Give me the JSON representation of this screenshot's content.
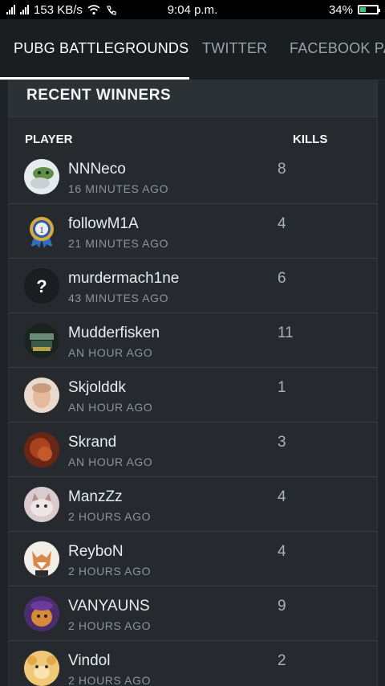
{
  "status_bar": {
    "network_speed": "153 KB/s",
    "time": "9:04 p.m.",
    "battery": "34%",
    "battery_level": 0.34
  },
  "tabs": [
    {
      "label": "PUBG BATTLEGROUNDS",
      "active": true
    },
    {
      "label": "TWITTER",
      "active": false
    },
    {
      "label": "FACEBOOK PA",
      "active": false
    }
  ],
  "card": {
    "title": "RECENT WINNERS",
    "col_player": "PLAYER",
    "col_kills": "KILLS"
  },
  "rows": [
    {
      "name": "NNNeco",
      "time": "16 MINUTES AGO",
      "kills": "8",
      "avatar": "frog-avatar"
    },
    {
      "name": "followM1A",
      "time": "21 MINUTES AGO",
      "kills": "4",
      "avatar": "medal-avatar"
    },
    {
      "name": "murdermach1ne",
      "time": "43 MINUTES AGO",
      "kills": "6",
      "avatar": "question-avatar"
    },
    {
      "name": "Mudderfisken",
      "time": "AN HOUR AGO",
      "kills": "11",
      "avatar": "tank-avatar"
    },
    {
      "name": "Skjolddk",
      "time": "AN HOUR AGO",
      "kills": "1",
      "avatar": "face-avatar"
    },
    {
      "name": "Skrand",
      "time": "AN HOUR AGO",
      "kills": "3",
      "avatar": "orange-avatar"
    },
    {
      "name": "ManzZz",
      "time": "2 HOURS AGO",
      "kills": "4",
      "avatar": "cat-avatar"
    },
    {
      "name": "ReyboN",
      "time": "2 HOURS AGO",
      "kills": "4",
      "avatar": "fox-avatar"
    },
    {
      "name": "VANYAUNS",
      "time": "2 HOURS AGO",
      "kills": "9",
      "avatar": "cartoon-avatar"
    },
    {
      "name": "Vindol",
      "time": "2 HOURS AGO",
      "kills": "2",
      "avatar": "bear-avatar"
    }
  ]
}
